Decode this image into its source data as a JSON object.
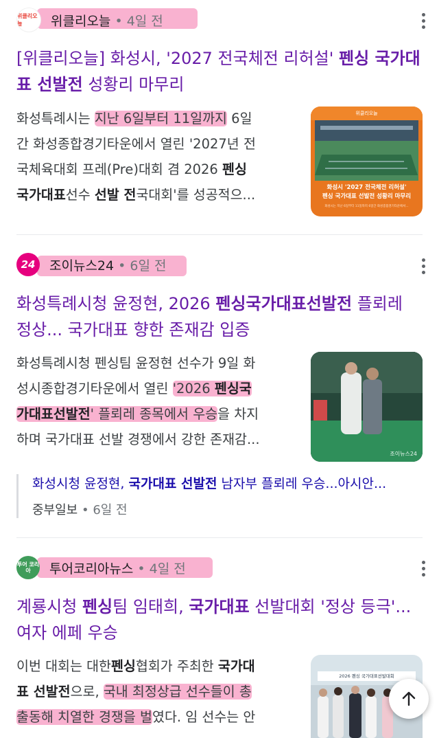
{
  "results": [
    {
      "source": "위클리오늘",
      "age": "4일 전",
      "favicon_text": "위클리오늘",
      "title_parts": [
        "[위클리오늘] 화성시, '2027 전국체전 리허설' ",
        "펜싱 국가대표 선발전",
        " 성황리 마무리"
      ],
      "snippet_lines": [
        [
          "화성특례시는 ",
          "지난 6일부터 11일까지",
          " 6일"
        ],
        [
          "간 화성종합경기타운에서 열린 '2027년 전"
        ],
        [
          "국체육대회 프레(Pre)대회 겸 2026 ",
          "펜싱"
        ],
        [
          "국가대표",
          "선수 ",
          "선발 전",
          "국대회'를 성공적으..."
        ]
      ],
      "thumb": {
        "header": "위클리오늘",
        "caption_line1": "화성시 '2027 전국체전 리허설'",
        "caption_line2": "펜싱 국가대표 선발전 성황리 마무리",
        "caption_small": "화성시는 지난 6일부터 11일까지 6일간 화성종합경기타운에서..."
      }
    },
    {
      "source": "조이뉴스24",
      "age": "6일 전",
      "favicon_text": "24",
      "title_parts": [
        "화성특례시청 윤정현, 2026 ",
        "펜싱국가대표선발전",
        " 플뢰레"
      ],
      "title_line2": "정상... 국가대표 향한 존재감 입증",
      "snippet_lines": [
        [
          "화성특례시청 펜싱팀 윤정현 선수가 9일 화"
        ],
        [
          "성시종합경기타운에서 열린 ",
          "'2026 ",
          "펜싱국"
        ],
        [
          "가대표선발전",
          "' 플뢰레 종목에서 ",
          "우승",
          "을 차지"
        ],
        [
          "하며 국가대표 선발 경쟁에서 강한 존재감..."
        ]
      ],
      "thumb": {
        "caption": "조이뉴스24"
      },
      "related": {
        "title_parts": [
          "화성시청 윤정현, ",
          "국가대표 선발전",
          " 남자부 플뢰레 우승...아시안..."
        ],
        "source": "중부일보",
        "age": "6일 전"
      }
    },
    {
      "source": "투어코리아뉴스",
      "age": "4일 전",
      "favicon_text": "투어 코리아",
      "title_parts": [
        "계룡시청 ",
        "펜싱",
        "팀 임태희, ",
        "국가대표",
        " 선발대회 '정상 등극'..."
      ],
      "title_line2": "여자 에페 우승",
      "snippet_lines": [
        [
          "이번 대회는 대한",
          "펜싱",
          "협회가 주최한 ",
          "국가대"
        ],
        [
          "표 선발전",
          "으로, ",
          "국내 최정상급 선수들이 총"
        ],
        [
          "출동해 치열한 경쟁을 벌",
          "였다. 임 선수는 안"
        ]
      ],
      "thumb": {
        "banner": "2026 펜싱 국가대표선발대회"
      }
    }
  ],
  "fab": {
    "icon": "arrow-up-icon"
  },
  "colors": {
    "title": "#681da8",
    "highlight": "#f472aa",
    "related_link": "#1a0dab"
  }
}
